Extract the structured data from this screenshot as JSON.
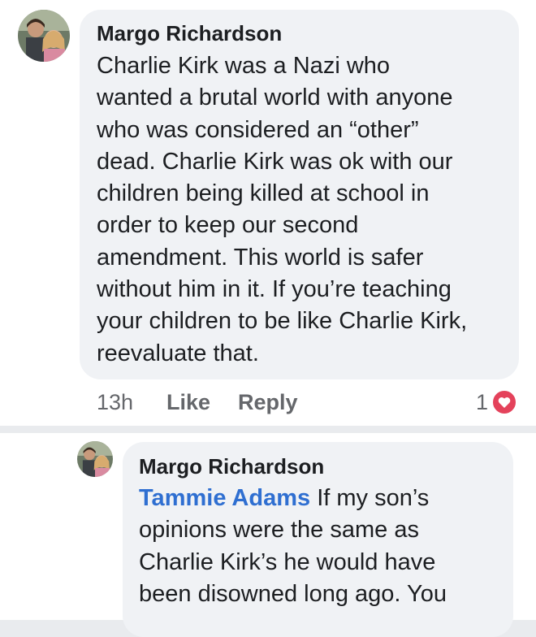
{
  "comment": {
    "author": "Margo Richardson",
    "text": "Charlie Kirk was a Nazi who\nwanted a brutal world with anyone\nwho was considered an “other”\ndead. Charlie Kirk was ok with our\nchildren being killed at school in\norder to keep our second\namendment. This world is safer\nwithout him in it. If you’re teaching\nyour children to be like Charlie Kirk,\nreevaluate that.",
    "time": "13h",
    "like_label": "Like",
    "reply_label": "Reply",
    "reaction_count": "1",
    "reaction_icon": "heart-icon",
    "reaction_color": "#e4425b"
  },
  "reply": {
    "author": "Margo Richardson",
    "mention": "Tammie Adams",
    "text_first_line": " If my son’s",
    "text_rest": "opinions were the same as\nCharlie Kirk’s he would have\nbeen disowned long ago. You",
    "mention_color": "#2f6fd1"
  }
}
